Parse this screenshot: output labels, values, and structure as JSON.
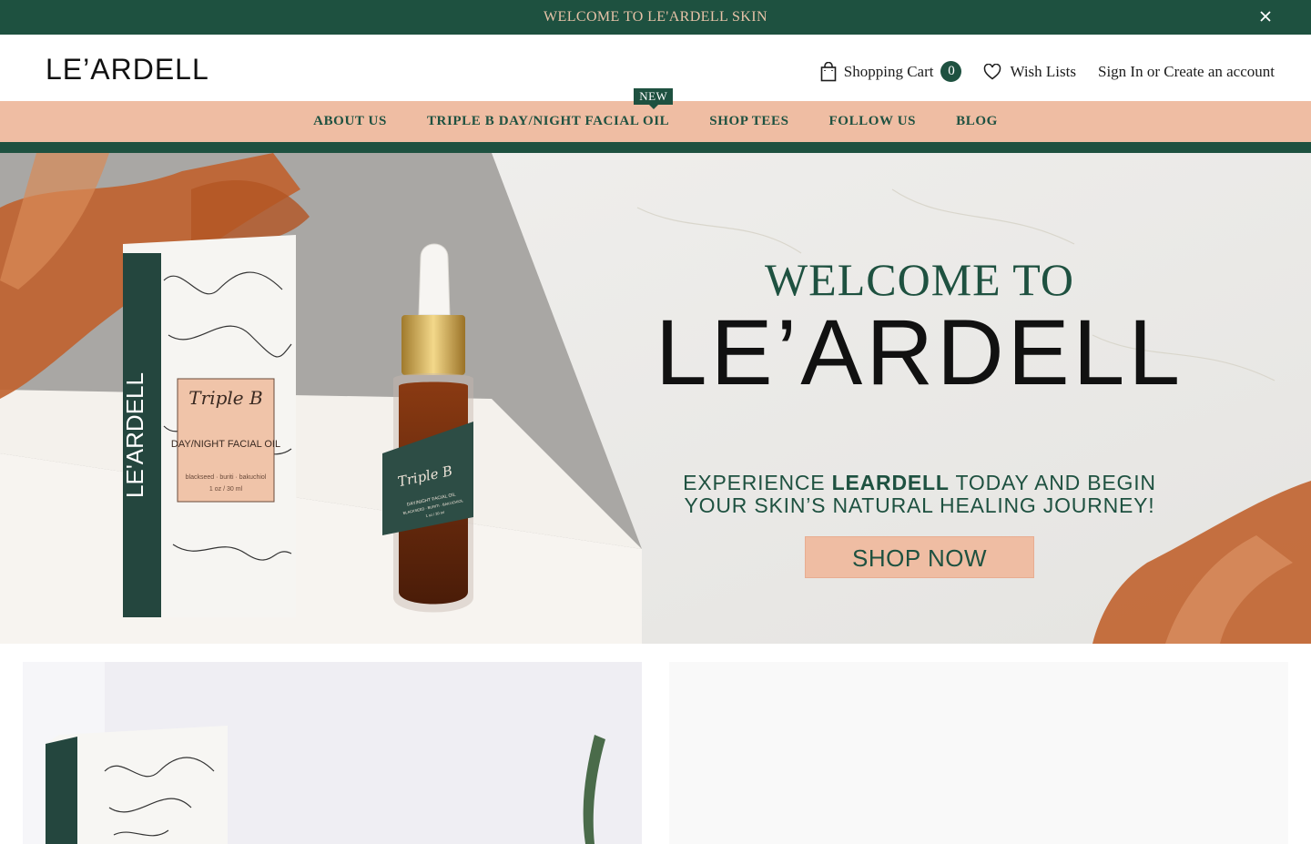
{
  "announcement": {
    "text": "WELCOME TO LE'ARDELL SKIN"
  },
  "header": {
    "logo": "LE’ARDELL",
    "cart_label": "Shopping Cart",
    "cart_count": "0",
    "wishlist_label": "Wish Lists",
    "signin_label": "Sign In or Create an account"
  },
  "nav": {
    "items": [
      {
        "label": "ABOUT US"
      },
      {
        "label": "TRIPLE B DAY/NIGHT FACIAL OIL",
        "badge": "NEW"
      },
      {
        "label": "SHOP TEES"
      },
      {
        "label": "FOLLOW US"
      },
      {
        "label": "BLOG"
      }
    ]
  },
  "hero": {
    "welcome": "WELCOME TO",
    "brand": "LE’ARDELL",
    "tagline_pre": "EXPERIENCE ",
    "tagline_brand": "LEARDELL",
    "tagline_post": " TODAY AND BEGIN",
    "tagline_line2": "YOUR SKIN’S NATURAL HEALING JOURNEY!",
    "cta": "SHOP NOW",
    "box_brand": "LE'ARDELL",
    "box_product_script": "Triple B",
    "box_product_name": "DAY/NIGHT FACIAL OIL",
    "box_ingredients": "blackseed · buriti · bakuchiol",
    "box_size": "1 oz / 30 ml",
    "bottle_script": "Triple B",
    "bottle_name": "DAY/NIGHT FACIAL OIL",
    "bottle_ingredients": "BLACKSEED · BURITI · BAKUCHIOL",
    "bottle_size": "1 oz / 30 ml"
  },
  "colors": {
    "brand_green": "#1e5140",
    "peach": "#efbda3",
    "copper": "#c0622e"
  }
}
